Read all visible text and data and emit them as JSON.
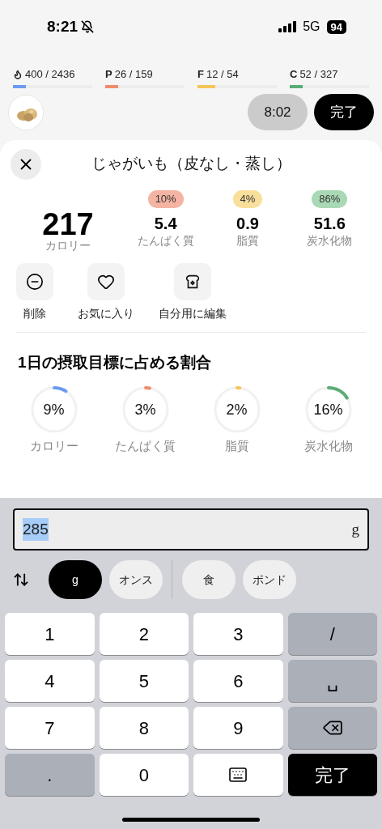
{
  "status_bar": {
    "time": "8:21",
    "network": "5G",
    "battery": "94"
  },
  "daily_totals": [
    {
      "kind": "calorie",
      "value": "400 / 2436",
      "level": 0.16,
      "color": "#6b9bf2"
    },
    {
      "kind": "letter",
      "letter": "P",
      "value": "26 / 159",
      "level": 0.16,
      "color": "#f08c6c"
    },
    {
      "kind": "letter",
      "letter": "F",
      "value": "12 / 54",
      "level": 0.22,
      "color": "#f5c55a"
    },
    {
      "kind": "letter",
      "letter": "C",
      "value": "52 / 327",
      "level": 0.16,
      "color": "#5aad74"
    }
  ],
  "meal_bar": {
    "time": "8:02",
    "done": "完了"
  },
  "food": {
    "title": "じゃがいも（皮なし・蒸し）",
    "calories": "217",
    "calories_label": "カロリー",
    "macros": [
      {
        "percent": "10%",
        "value": "5.4",
        "label": "たんぱく質",
        "color": "#f4b3a3"
      },
      {
        "percent": "4%",
        "value": "0.9",
        "label": "脂質",
        "color": "#f9df9c"
      },
      {
        "percent": "86%",
        "value": "51.6",
        "label": "炭水化物",
        "color": "#a9d9b4"
      }
    ],
    "actions": [
      {
        "kind": "remove",
        "label": "削除"
      },
      {
        "kind": "favorite",
        "label": "お気に入り"
      },
      {
        "kind": "edit",
        "label": "自分用に編集"
      }
    ]
  },
  "daily_share": {
    "title": "1日の摂取目標に占める割合",
    "items": [
      {
        "percent": "9%",
        "label": "カロリー",
        "color": "#6b9bf2"
      },
      {
        "percent": "3%",
        "label": "たんぱく質",
        "color": "#f08c6c"
      },
      {
        "percent": "2%",
        "label": "脂質",
        "color": "#f5c55a"
      },
      {
        "percent": "16%",
        "label": "炭水化物",
        "color": "#5aad74"
      }
    ]
  },
  "amount": {
    "value": "285",
    "value_selected": true,
    "unit": "g"
  },
  "units": [
    [
      {
        "label": "g",
        "selected": true
      },
      {
        "label": "オンス",
        "selected": false
      }
    ],
    [
      {
        "label": "食",
        "selected": false
      },
      {
        "label": "ポンド",
        "selected": false
      }
    ]
  ],
  "keys": [
    {
      "kind": "digit",
      "label": "1"
    },
    {
      "kind": "digit",
      "label": "2"
    },
    {
      "kind": "digit",
      "label": "3"
    },
    {
      "kind": "function",
      "label": "/"
    },
    {
      "kind": "digit",
      "label": "4"
    },
    {
      "kind": "digit",
      "label": "5"
    },
    {
      "kind": "digit",
      "label": "6"
    },
    {
      "kind": "function",
      "label": "␣"
    },
    {
      "kind": "digit",
      "label": "7"
    },
    {
      "kind": "digit",
      "label": "8"
    },
    {
      "kind": "digit",
      "label": "9"
    },
    {
      "kind": "backspace"
    },
    {
      "kind": "function",
      "label": "."
    },
    {
      "kind": "digit",
      "label": "0"
    },
    {
      "kind": "keyboard"
    },
    {
      "kind": "done",
      "label": "完了"
    }
  ]
}
